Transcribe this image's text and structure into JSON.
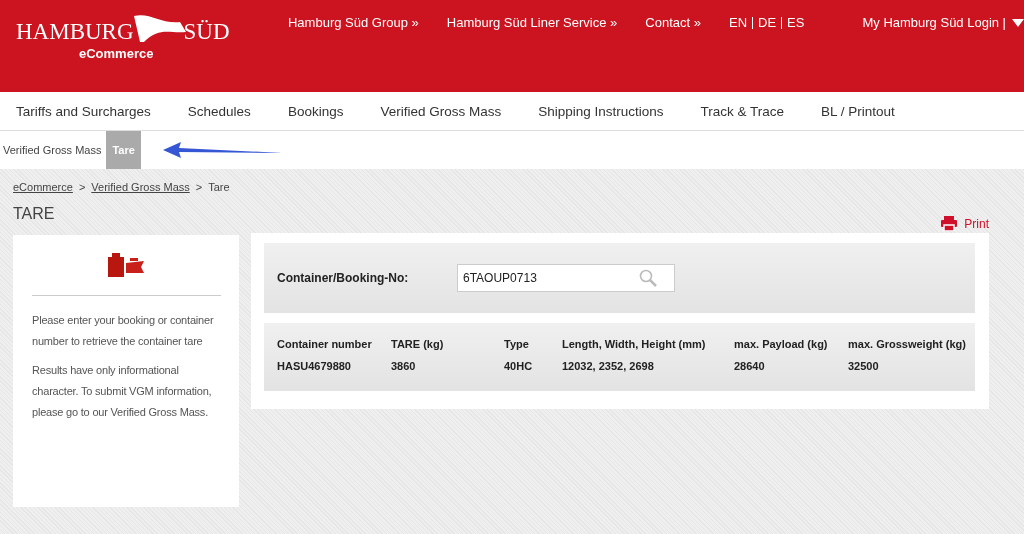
{
  "logo": {
    "word_1": "HAMBURG",
    "word_2": "SÜD",
    "subtitle": "eCommerce"
  },
  "top_links": [
    "Hamburg Süd Group »",
    "Hamburg Süd Liner Service »",
    "Contact »"
  ],
  "languages": [
    "EN",
    "DE",
    "ES"
  ],
  "login": "My Hamburg Süd Login |",
  "nav": [
    {
      "label": "Tariffs and Surcharges"
    },
    {
      "label": "Schedules"
    },
    {
      "label": "Bookings"
    },
    {
      "label": "Verified Gross Mass"
    },
    {
      "label": "Shipping Instructions"
    },
    {
      "label": "Track & Trace"
    },
    {
      "label": "BL / Printout"
    }
  ],
  "subnav": [
    {
      "label": "Verified Gross Mass",
      "selected": false
    },
    {
      "label": "Tare",
      "selected": true
    }
  ],
  "breadcrumb": [
    {
      "label": "eCommerce",
      "link": true
    },
    {
      "label": "Verified Gross Mass",
      "link": true
    },
    {
      "label": "Tare",
      "link": false
    }
  ],
  "breadcrumb_separators": [
    ">",
    ">"
  ],
  "page_title": "TARE",
  "print": "Print",
  "info": [
    "Please enter your booking or container number to retrieve the container tare",
    "Results have only informational character. To submit VGM information, please go to our Verified Gross Mass."
  ],
  "search": {
    "label": "Container/Booking-No:",
    "value": "6TAOUP0713"
  },
  "table": {
    "columns": [
      "Container number",
      "TARE (kg)",
      "Type",
      "Length, Width, Height (mm)",
      "max. Payload (kg)",
      "max. Grossweight (kg)"
    ],
    "rows": [
      [
        "HASU4679880",
        "3860",
        "40HC",
        "12032, 2352, 2698",
        "28640",
        "32500"
      ]
    ]
  }
}
